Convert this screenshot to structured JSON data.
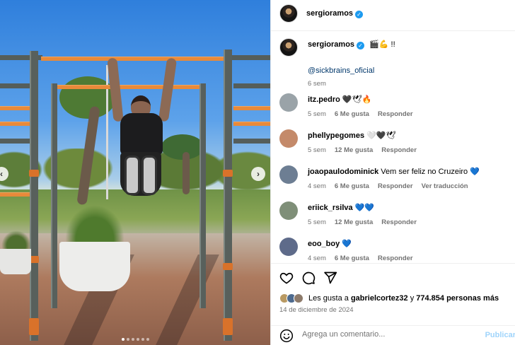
{
  "post": {
    "author": "sergioramos",
    "caption_emojis": "🎬💪 !!",
    "caption_mention": "@sickbrains_oficial",
    "caption_time": "6 sem"
  },
  "comments": [
    {
      "user": "itz.pedro",
      "text": "🖤🕊🔥",
      "time": "5 sem",
      "likes": "6 Me gusta",
      "reply": "Responder",
      "avatar_color": "#9aa3a8"
    },
    {
      "user": "phellypegomes",
      "text": "🤍🖤🕊",
      "time": "5 sem",
      "likes": "12 Me gusta",
      "reply": "Responder",
      "avatar_color": "#c48a6a"
    },
    {
      "user": "joaopaulodominick",
      "text": "Vem ser feliz no Cruzeiro 💙",
      "time": "4 sem",
      "likes": "6 Me gusta",
      "reply": "Responder",
      "translate": "Ver traducción",
      "avatar_color": "#6d7e93"
    },
    {
      "user": "eriick_rsilva",
      "text": "💙💙",
      "time": "5 sem",
      "likes": "12 Me gusta",
      "reply": "Responder",
      "avatar_color": "#7f8f78"
    },
    {
      "user": "eoo_boy",
      "text": "💙",
      "time": "4 sem",
      "likes": "6 Me gusta",
      "reply": "Responder",
      "avatar_color": "#5e6b8a"
    }
  ],
  "likes": {
    "prefix": "Les gusta a",
    "first_user": "gabrielcortez32",
    "connector": "y",
    "count": "774.854 personas más"
  },
  "date": "14 de diciembre de 2024",
  "comment_input": {
    "placeholder": "Agrega un comentario...",
    "post_label": "Publicar"
  },
  "carousel": {
    "total": 6,
    "active_index": 0
  },
  "colors": {
    "verified": "#1d9bf0",
    "link": "#00376b",
    "muted": "#737373"
  },
  "icons": [
    "heart-icon",
    "comment-icon",
    "share-icon",
    "smiley-icon",
    "chevron-left-icon",
    "chevron-right-icon",
    "verified-icon"
  ]
}
